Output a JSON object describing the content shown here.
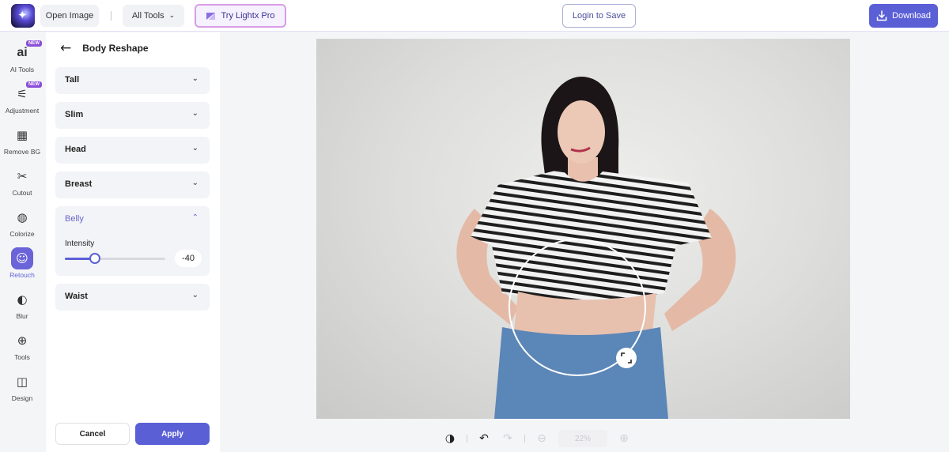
{
  "topbar": {
    "open_image": "Open Image",
    "all_tools": "All Tools",
    "try_pro": "Try Lightx Pro",
    "login": "Login to Save",
    "download": "Download"
  },
  "rail": {
    "items": [
      {
        "label": "AI Tools",
        "icon": "ai-icon",
        "badge": "NEW"
      },
      {
        "label": "Adjustment",
        "icon": "sliders-icon",
        "badge": "NEW"
      },
      {
        "label": "Remove BG",
        "icon": "remove-bg-icon"
      },
      {
        "label": "Cutout",
        "icon": "scissors-icon"
      },
      {
        "label": "Colorize",
        "icon": "drop-icon"
      },
      {
        "label": "Retouch",
        "icon": "retouch-icon",
        "active": true
      },
      {
        "label": "Blur",
        "icon": "leaf-icon"
      },
      {
        "label": "Tools",
        "icon": "tools-icon"
      },
      {
        "label": "Design",
        "icon": "layout-icon"
      }
    ]
  },
  "panel": {
    "title": "Body Reshape",
    "sections": [
      {
        "label": "Tall"
      },
      {
        "label": "Slim"
      },
      {
        "label": "Head"
      },
      {
        "label": "Breast"
      },
      {
        "label": "Belly",
        "open": true
      },
      {
        "label": "Waist"
      }
    ],
    "belly": {
      "intensity_label": "Intensity",
      "intensity_value": "-40",
      "slider_fraction": 0.3
    },
    "cancel": "Cancel",
    "apply": "Apply"
  },
  "bottom": {
    "zoom": "22%"
  },
  "colors": {
    "accent": "#5b5fd6",
    "pro_border": "#d99ce6"
  }
}
